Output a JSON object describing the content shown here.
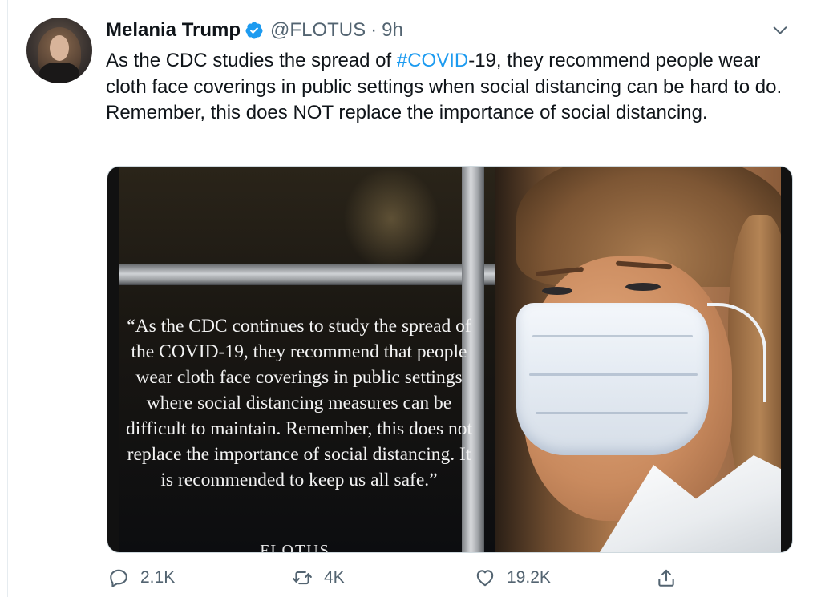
{
  "tweet": {
    "author": {
      "name": "Melania Trump",
      "handle": "@FLOTUS",
      "time": "9h",
      "verified": true
    },
    "text_before": "As the CDC studies the spread of ",
    "hashtag": "#COVID",
    "text_after": "-19, they recommend people wear cloth face coverings in public settings when social distancing can be hard to do. Remember, this does NOT replace the importance of social distancing.",
    "media": {
      "quote": "“As the CDC continues to study the spread of the COVID-19, they recommend that people wear cloth face coverings in public settings where social distancing measures can be difficult to maintain. Remember, this does not replace the importance of social distancing. It is recommended to keep us all safe.”",
      "signature": "FLOTUS"
    },
    "actions": {
      "replies": "2.1K",
      "retweets": "4K",
      "likes": "19.2K"
    }
  },
  "colors": {
    "accent": "#1d9bf0",
    "secondary_text": "#536471",
    "primary_text": "#0f1419",
    "border": "#cfd9de"
  },
  "icons": [
    "verified-badge-icon",
    "chevron-down-icon",
    "reply-icon",
    "retweet-icon",
    "like-icon",
    "share-icon"
  ]
}
